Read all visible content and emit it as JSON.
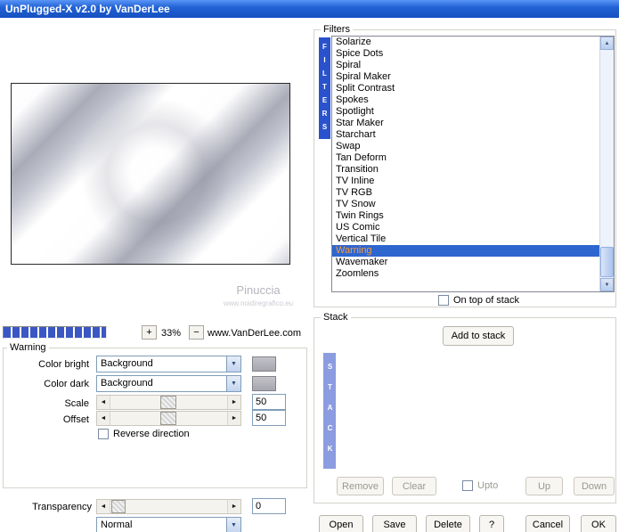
{
  "window": {
    "title": "UnPlugged-X v2.0 by VanDerLee"
  },
  "preview": {
    "watermark": "Pinuccia",
    "watermark_url": "www.noidiregrafico.eu"
  },
  "zoom": {
    "plus": "+",
    "level": "33%",
    "minus": "−",
    "website": "www.VanDerLee.com"
  },
  "filters": {
    "group_label": "Filters",
    "vertical_label": "FILTERS",
    "items": [
      "Solarize",
      "Spice Dots",
      "Spiral",
      "Spiral Maker",
      "Split Contrast",
      "Spokes",
      "Spotlight",
      "Star Maker",
      "Starchart",
      "Swap",
      "Tan Deform",
      "Transition",
      "TV Inline",
      "TV RGB",
      "TV Snow",
      "Twin Rings",
      "US Comic",
      "Vertical Tile",
      "Warning",
      "Wavemaker",
      "Zoomlens"
    ],
    "selected": "Warning",
    "on_top_label": "On top of stack"
  },
  "settings": {
    "group_label": "Warning",
    "color_bright": {
      "label": "Color bright",
      "value": "Background"
    },
    "color_dark": {
      "label": "Color dark",
      "value": "Background"
    },
    "scale": {
      "label": "Scale",
      "value": "50"
    },
    "offset": {
      "label": "Offset",
      "value": "50"
    },
    "reverse_label": "Reverse direction"
  },
  "transparency": {
    "label": "Transparency",
    "value": "0",
    "blend_mode": "Normal"
  },
  "stack": {
    "group_label": "Stack",
    "add_label": "Add to stack",
    "vertical_label": "STACK",
    "remove_label": "Remove",
    "clear_label": "Clear",
    "upto_label": "Upto",
    "up_label": "Up",
    "down_label": "Down"
  },
  "actions": {
    "open": "Open",
    "save": "Save",
    "delete": "Delete",
    "help": "?",
    "cancel": "Cancel",
    "ok": "OK"
  },
  "icons": {
    "dropdown_arrow": "▼",
    "arrow_left": "◄",
    "arrow_right": "►",
    "arrow_up": "▲",
    "arrow_down": "▼"
  },
  "colors": {
    "titlebar_blue": "#2263d5",
    "selection_bg": "#2e66d0",
    "selection_text": "#ff9a33",
    "filters_bar": "#2a52cc",
    "stack_bar": "#8c9ce0",
    "progress_blue": "#3a57c4"
  }
}
